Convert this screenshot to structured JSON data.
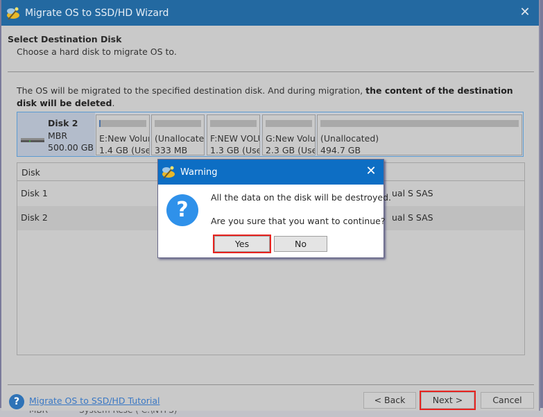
{
  "window": {
    "title": "Migrate OS to SSD/HD Wizard",
    "close_icon": "close-icon"
  },
  "header": {
    "title": "Select Destination Disk",
    "subtitle": "Choose a hard disk to migrate OS to."
  },
  "description": {
    "normal": "The OS will be migrated to the specified destination disk. And during migration, ",
    "bold": "the content of the destination disk will be deleted",
    "end": "."
  },
  "disk_map": {
    "name": "Disk 2",
    "type": "MBR",
    "size": "500.00 GB",
    "partitions": [
      {
        "label": "E:New Volur",
        "size": "1.4 GB (Use"
      },
      {
        "label": "(Unallocatec",
        "size": "333 MB"
      },
      {
        "label": "F:NEW VOLU",
        "size": "1.3 GB (Use"
      },
      {
        "label": "G:New Volu",
        "size": "2.3 GB (Use"
      },
      {
        "label": "(Unallocated)",
        "size": "494.7 GB"
      }
    ]
  },
  "disk_table": {
    "header": "Disk",
    "rows": [
      {
        "disk": "Disk 1",
        "model": "ual S SAS",
        "selected": false
      },
      {
        "disk": "Disk 2",
        "model": "ual S SAS",
        "selected": true
      }
    ]
  },
  "footer": {
    "tutorial_link": "Migrate OS to SSD/HD Tutorial",
    "back": "< Back",
    "next": "Next >",
    "cancel": "Cancel"
  },
  "dialog": {
    "title": "Warning",
    "message1": "All the data on the disk will be destroyed.",
    "message2": "Are you sure that you want to continue?",
    "yes": "Yes",
    "no": "No",
    "icon": "question-icon"
  },
  "background_window": {
    "text1": "MBR",
    "text2": "System Rese ( C:\\NTFS)"
  },
  "colors": {
    "titlebar": "#2369a1",
    "dialog_titlebar": "#0d6ec4",
    "highlight": "#e8231f",
    "link": "#3a78c4",
    "selection_border": "#5b9ad1"
  }
}
